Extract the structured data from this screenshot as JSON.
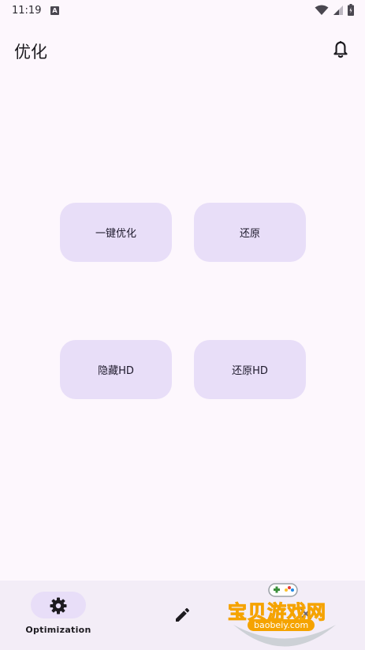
{
  "status_bar": {
    "time": "11:19",
    "notification_icon": "A"
  },
  "header": {
    "title": "优化"
  },
  "actions": [
    {
      "label": "一键优化"
    },
    {
      "label": "还原"
    },
    {
      "label": "隐藏HD"
    },
    {
      "label": "还原HD"
    }
  ],
  "bottom_nav": {
    "items": [
      {
        "label": "Optimization",
        "icon": "gear-icon",
        "selected": true
      },
      {
        "label": "",
        "icon": "pencil-icon",
        "selected": false
      },
      {
        "label": "",
        "icon": "nav-icon",
        "selected": false
      }
    ]
  },
  "watermark": {
    "text": "宝贝游戏网",
    "url": "baobeiy.com"
  },
  "colors": {
    "background": "#fdf7fd",
    "button_bg": "#e8def8",
    "nav_bg": "#f3edf7",
    "text": "#1d1b20"
  }
}
